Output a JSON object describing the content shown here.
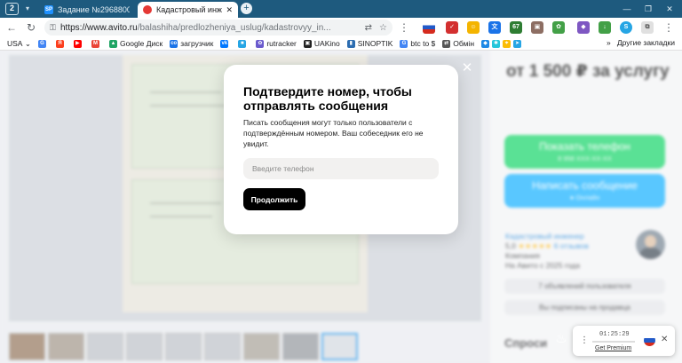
{
  "browser": {
    "tab_count": "2",
    "tabs": [
      {
        "label": "Задание №2968800 - про",
        "icon": "sp-favicon"
      },
      {
        "label": "Кадастровый инженер",
        "icon": "avito-favicon"
      }
    ],
    "url_domain": "https://www.avito.ru",
    "url_path": "/balashiha/predlozheniya_uslug/kadastrovyy_in..."
  },
  "bookmarks": [
    {
      "label": "USA",
      "icon": "",
      "color": "#ffffff"
    },
    {
      "label": "",
      "icon": "google-icon",
      "color": "#4285f4"
    },
    {
      "label": "",
      "icon": "yandex-icon",
      "color": "#fc3f1d"
    },
    {
      "label": "",
      "icon": "youtube-icon",
      "color": "#ff0000"
    },
    {
      "label": "",
      "icon": "gmail-icon",
      "color": "#ea4335"
    },
    {
      "label": "Google Диск",
      "icon": "drive-icon",
      "color": "#1fa463"
    },
    {
      "label": "загрузчик",
      "icon": "downloader-icon",
      "color": "#1a73e8"
    },
    {
      "label": "",
      "icon": "vk-icon",
      "color": "#0077ff"
    },
    {
      "label": "",
      "icon": "bookmark-icon",
      "color": "#26a5e4"
    },
    {
      "label": "rutracker",
      "icon": "rutracker-icon",
      "color": "#6a5acd"
    },
    {
      "label": "UAKino",
      "icon": "uakino-icon",
      "color": "#222222"
    },
    {
      "label": "SINOPTIK",
      "icon": "sinoptik-icon",
      "color": "#2b6cb0"
    },
    {
      "label": "btc to $",
      "icon": "google-icon",
      "color": "#4285f4"
    },
    {
      "label": "Обмін",
      "icon": "exchange-icon",
      "color": "#555555"
    }
  ],
  "bookmarks_other": "Другие закладки",
  "listing": {
    "price": "от 1 500 ₽ за услугу",
    "phone_button": "Показать телефон",
    "phone_masked": "8 958 XXX-XX-XX",
    "message_button": "Написать сообщение",
    "online_status": "Онлайн",
    "seller_name": "Кадастровый инженер",
    "rating": "5,0",
    "stars": "★★★★★",
    "reviews": "6 отзывов",
    "seller_type": "Компания",
    "since": "На Авито с 2025 года",
    "listings_count": "7 объявлений пользователя",
    "subscribed": "Вы подписаны на продавца",
    "ask_heading": "Спроси"
  },
  "modal": {
    "title": "Подтвердите номер, чтобы отправлять сообщения",
    "text": "Писать сообщения могут только пользователи с подтверждённым номером. Ваш собеседник его не увидит.",
    "input_placeholder": "Введите телефон",
    "continue_label": "Продолжить"
  },
  "recorder": {
    "time": "01:25:29",
    "link": "Get Premium"
  },
  "colors": {
    "phone_button": "#02d15c",
    "message_button": "#00aaff",
    "tabstrip": "#1e5a7e"
  }
}
